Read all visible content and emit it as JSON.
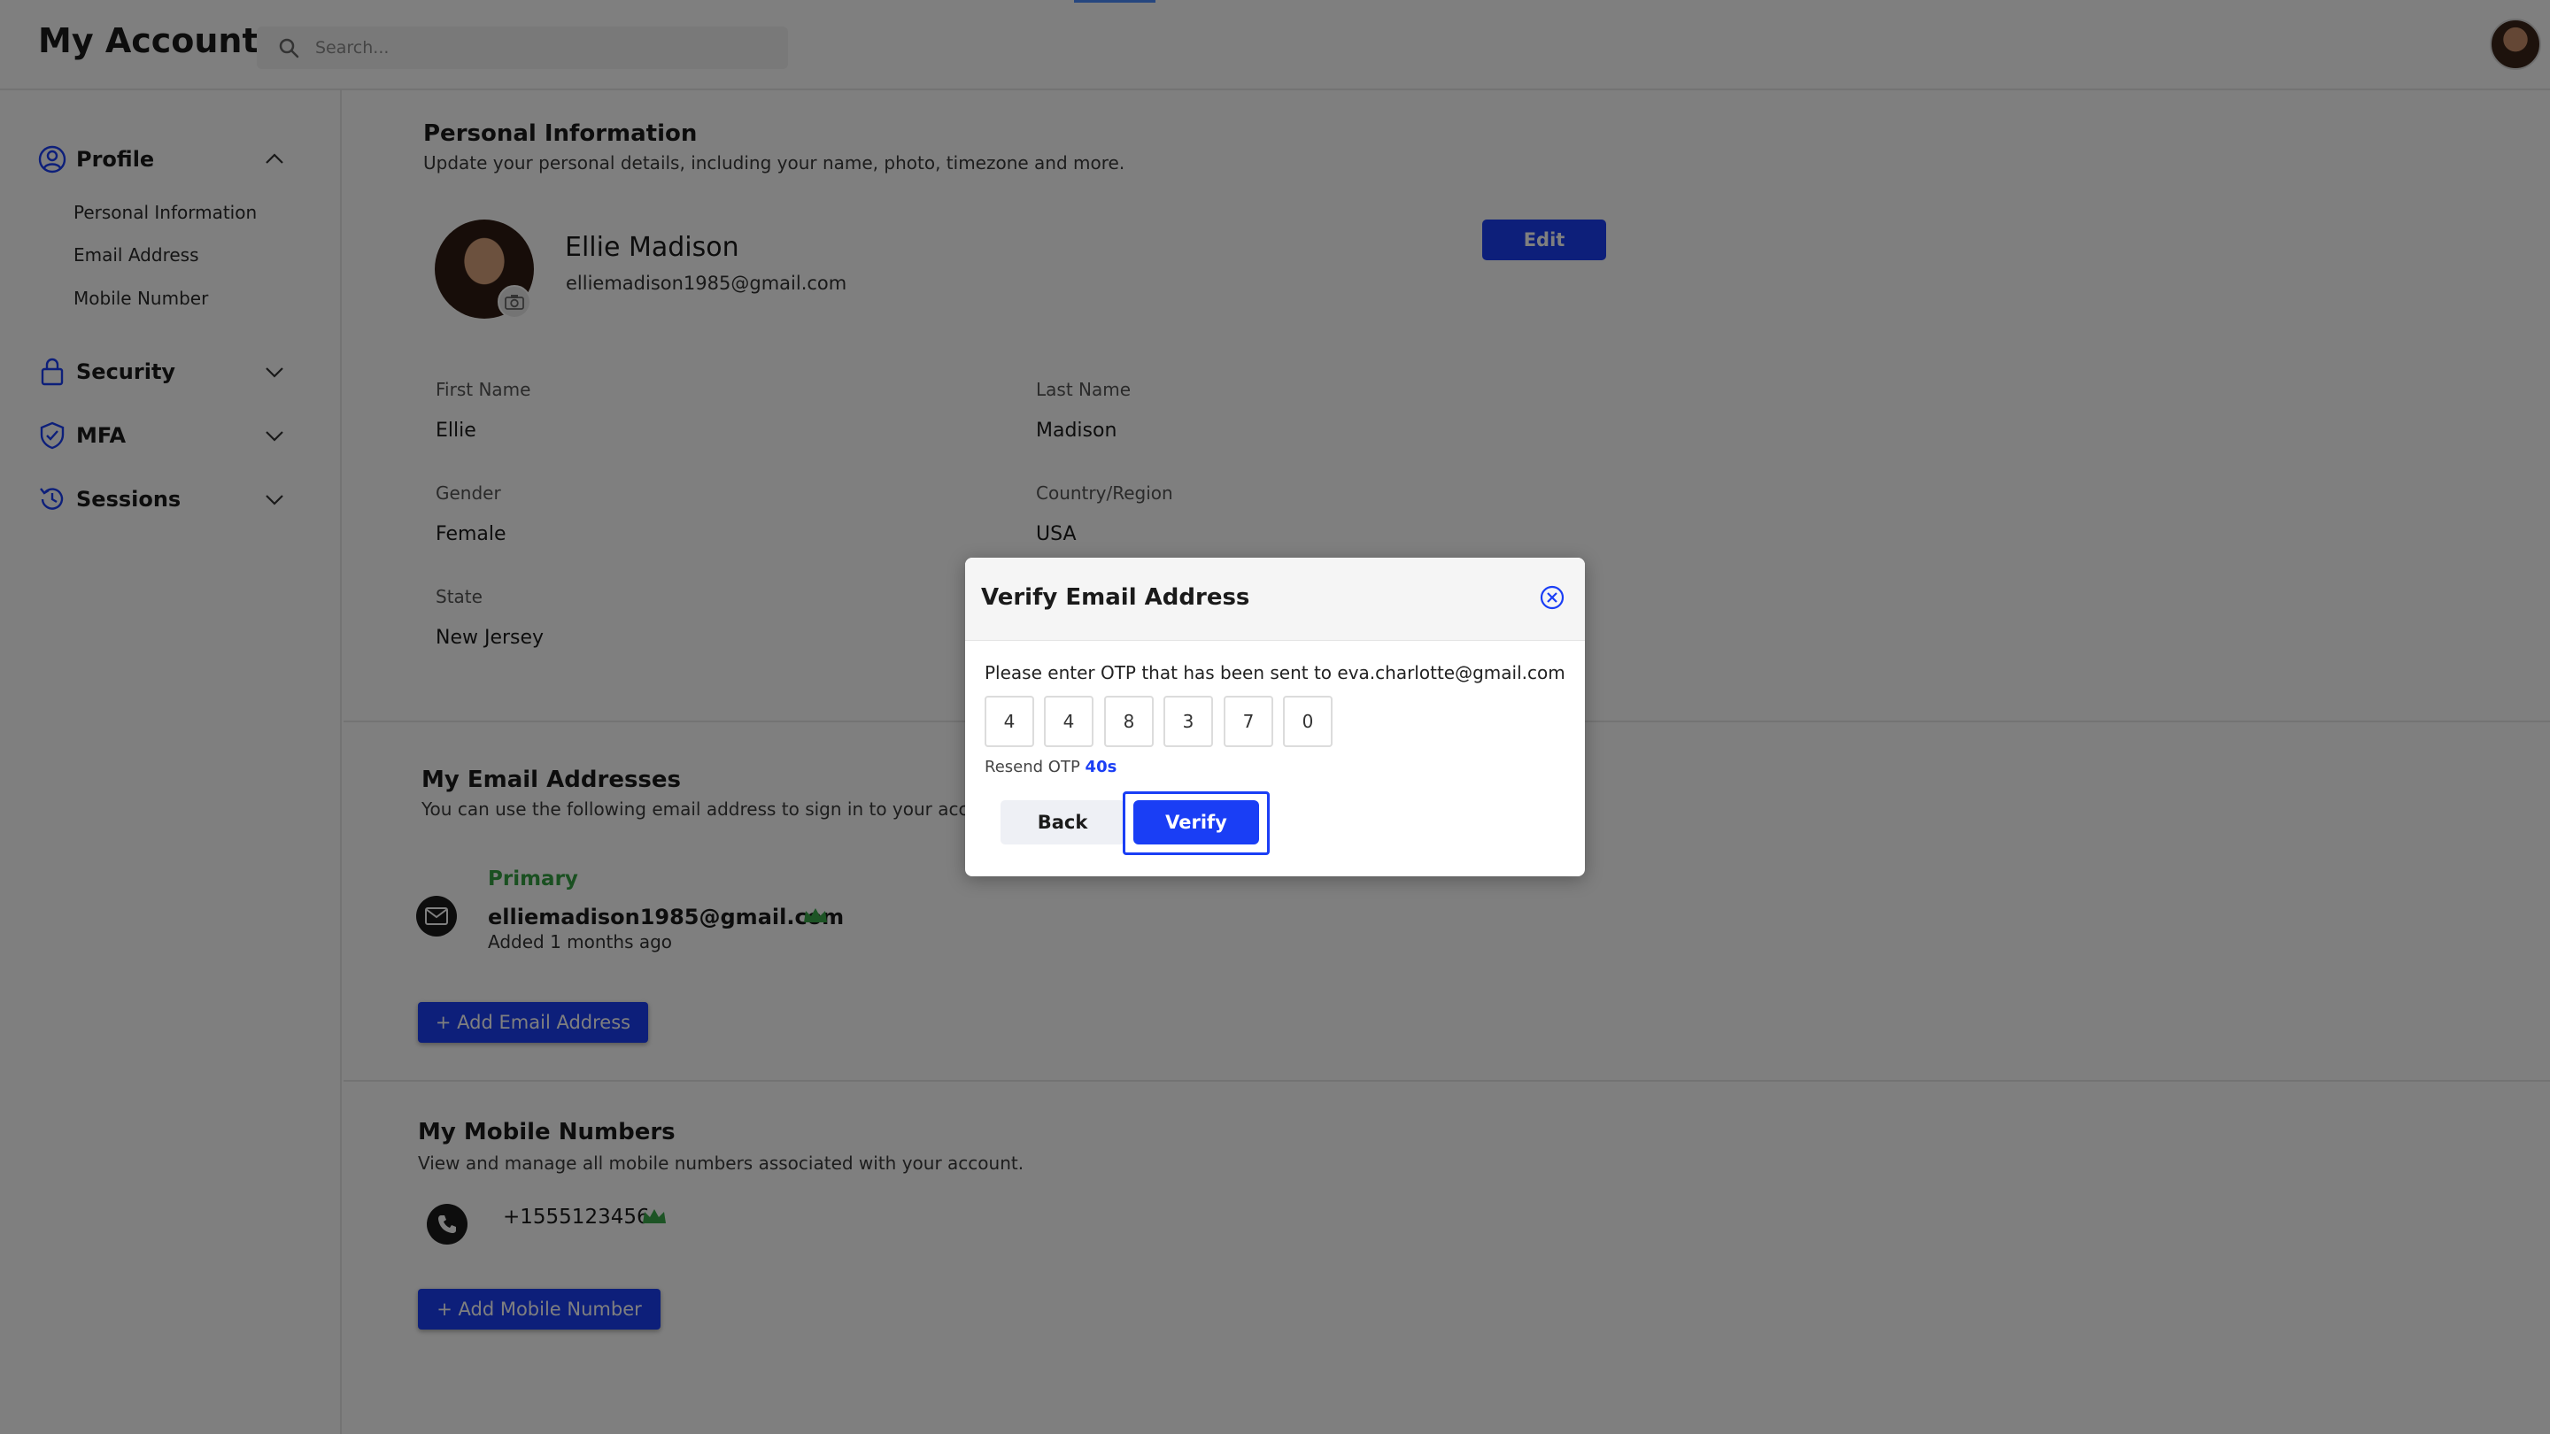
{
  "app": {
    "title": "My Account"
  },
  "search": {
    "placeholder": "Search..."
  },
  "sidebar": {
    "sections": [
      {
        "label": "Profile",
        "expanded": true,
        "items": [
          "Personal Information",
          "Email Address",
          "Mobile Number"
        ]
      },
      {
        "label": "Security",
        "expanded": false
      },
      {
        "label": "MFA",
        "expanded": false
      },
      {
        "label": "Sessions",
        "expanded": false
      }
    ]
  },
  "personal_info": {
    "title": "Personal Information",
    "description": "Update your personal details, including your name, photo, timezone and more.",
    "name": "Ellie Madison",
    "email": "elliemadison1985@gmail.com",
    "edit_label": "Edit",
    "fields": {
      "first_name": {
        "label": "First Name",
        "value": "Ellie"
      },
      "last_name": {
        "label": "Last Name",
        "value": "Madison"
      },
      "gender": {
        "label": "Gender",
        "value": "Female"
      },
      "country": {
        "label": "Country/Region",
        "value": "USA"
      },
      "state": {
        "label": "State",
        "value": "New Jersey"
      }
    }
  },
  "emails": {
    "title": "My Email Addresses",
    "description": "You can use the following email address to sign in to your acc",
    "primary_label": "Primary",
    "address": "elliemadison1985@gmail.com",
    "added": "Added 1 months ago",
    "add_label": "+ Add Email Address"
  },
  "mobiles": {
    "title": "My Mobile Numbers",
    "description": "View and manage all mobile numbers associated with your account.",
    "number": "+1555123456",
    "add_label": "+  Add Mobile Number"
  },
  "modal": {
    "title": "Verify Email Address",
    "message": "Please enter OTP that has been sent to eva.charlotte@gmail.com",
    "otp": [
      "4",
      "4",
      "8",
      "3",
      "7",
      "0"
    ],
    "resend_label": "Resend OTP",
    "resend_timer": "40s",
    "back_label": "Back",
    "verify_label": "Verify"
  },
  "colors": {
    "accent": "#1a3ef5",
    "primary_green": "#35a043",
    "crown_green": "#3aa84a"
  }
}
